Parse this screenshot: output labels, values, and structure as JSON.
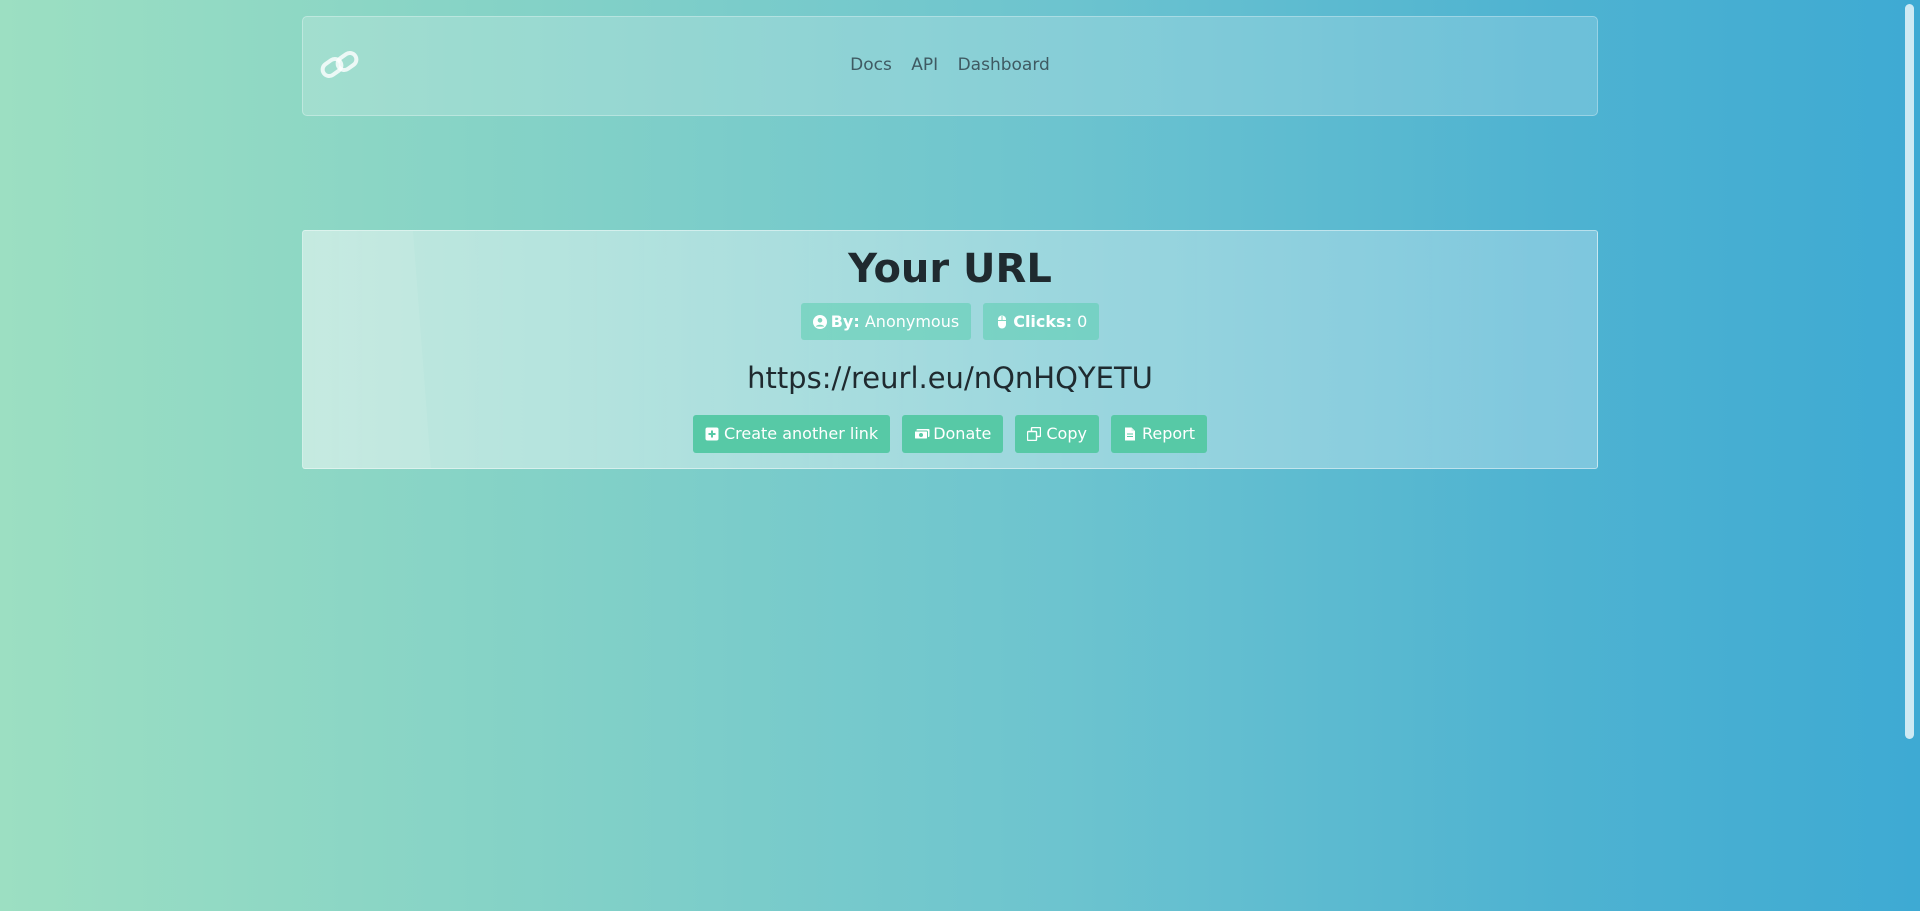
{
  "navbar": {
    "logo_icon": "link-icon",
    "links": [
      "Docs",
      "API",
      "Dashboard"
    ]
  },
  "card": {
    "title": "Your URL",
    "by_label": "By:",
    "by_value": "Anonymous",
    "clicks_label": "Clicks:",
    "clicks_value": "0",
    "short_url": "https://reurl.eu/nQnHQYETU",
    "buttons": {
      "create": "Create another link",
      "donate": "Donate",
      "copy": "Copy",
      "report": "Report"
    }
  },
  "colors": {
    "accent": "#57c9a6",
    "text_dark": "#1f2a2f"
  }
}
